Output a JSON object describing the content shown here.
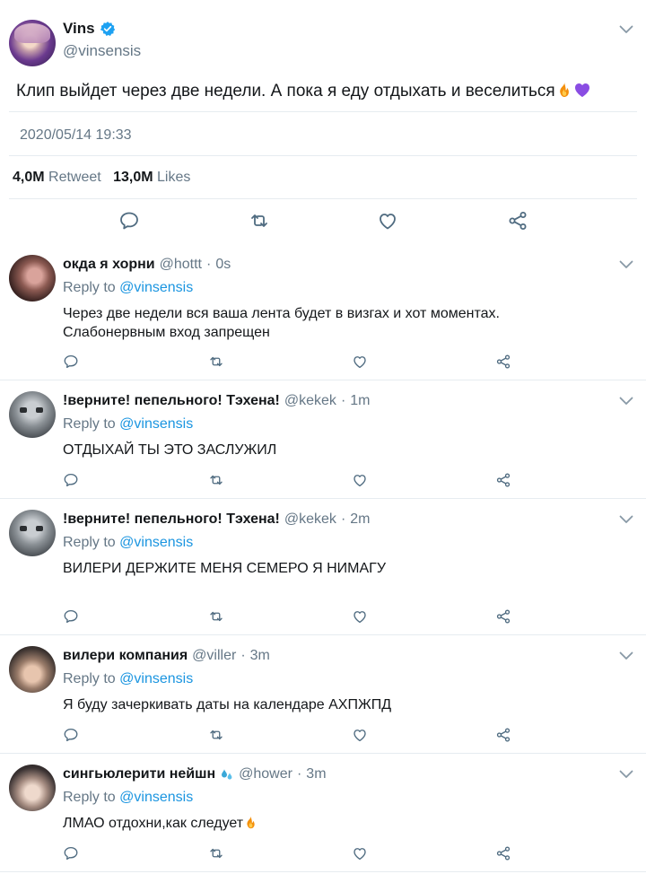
{
  "main_tweet": {
    "name": "Vins",
    "handle": "@vinsensis",
    "text": "Клип выйдет через две недели. А пока я еду отдыхать и веселиться",
    "timestamp": "2020/05/14 19:33",
    "retweets_count": "4,0M",
    "retweets_label": "Retweet",
    "likes_count": "13,0M",
    "likes_label": "Likes",
    "verified_color": "#1da1f2"
  },
  "replies": [
    {
      "name": "окда я хорни",
      "handle": "@hottt",
      "time": "0s",
      "reply_to_label": "Reply to",
      "reply_to_handle": "@vinsensis",
      "text_line1": "Через две недели вся ваша лента будет в визгах и хот моментах.",
      "text_line2": "Слабонервным вход запрещен"
    },
    {
      "name": "!верните! пепельного! Тэхена!",
      "handle": "@kekek",
      "time": "1m",
      "reply_to_label": "Reply to",
      "reply_to_handle": "@vinsensis",
      "text_line1": "ОТДЫХАЙ ТЫ ЭТО ЗАСЛУЖИЛ",
      "text_line2": ""
    },
    {
      "name": "!верните! пепельного! Тэхена!",
      "handle": "@kekek",
      "time": "2m",
      "reply_to_label": "Reply to",
      "reply_to_handle": "@vinsensis",
      "text_line1": "ВИЛЕРИ ДЕРЖИТЕ МЕНЯ СЕМЕРО Я НИМАГУ",
      "text_line2": ""
    },
    {
      "name": "вилери компания",
      "handle": "@viller",
      "time": "3m",
      "reply_to_label": "Reply to",
      "reply_to_handle": "@vinsensis",
      "text_line1": "Я буду зачеркивать даты на календаре АХПЖПД",
      "text_line2": ""
    },
    {
      "name": "сингьюлерити нейшн",
      "handle": "@hower",
      "time": "3m",
      "reply_to_label": "Reply to",
      "reply_to_handle": "@vinsensis",
      "text_line1": "ЛМАО отдохни,как следует",
      "text_line2": ""
    }
  ],
  "colors": {
    "accent": "#1b95e0",
    "muted": "#657786",
    "divider": "#e6ecf0",
    "icon": "#4f6b80"
  }
}
